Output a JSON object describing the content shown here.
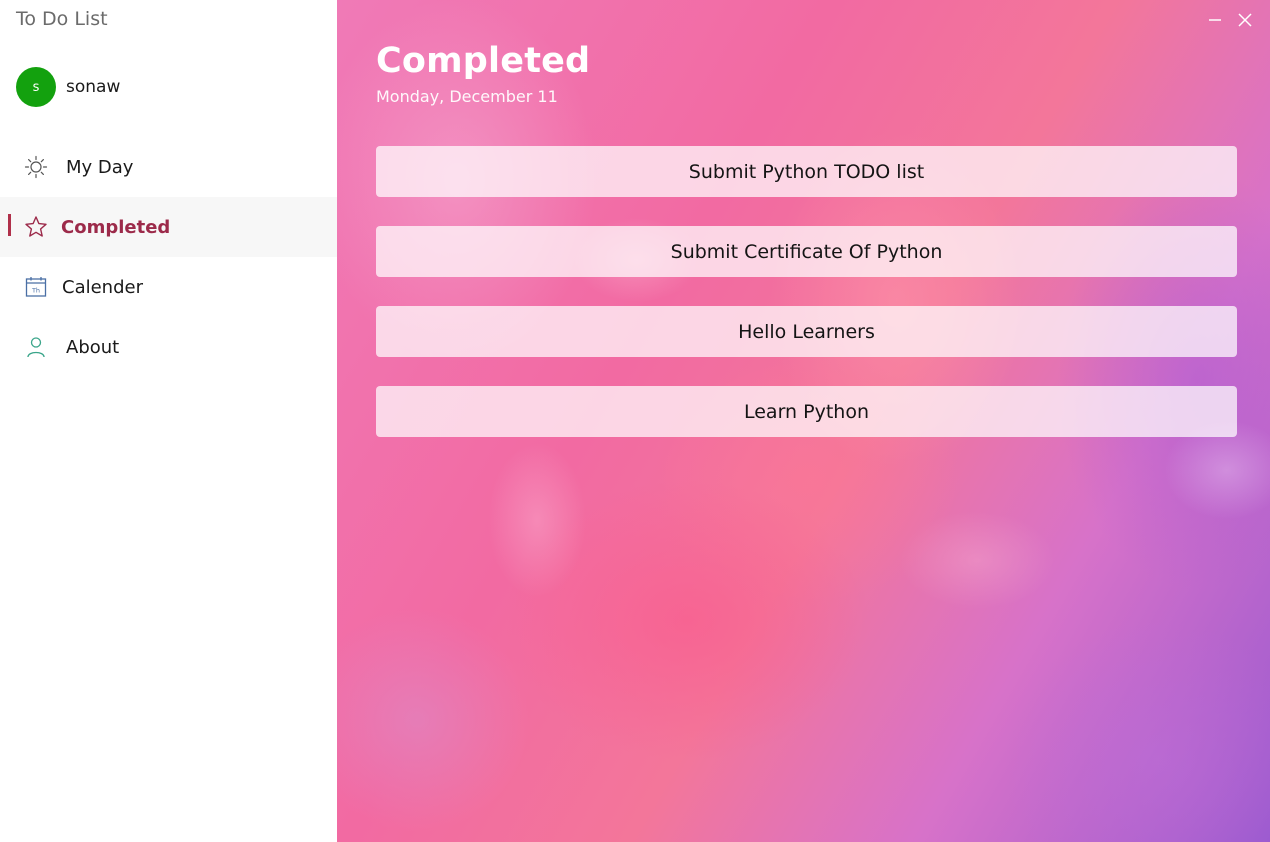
{
  "app": {
    "title": "To Do List"
  },
  "user": {
    "initial": "s",
    "name": "sonaw",
    "avatar_color": "#13a10e"
  },
  "sidebar": {
    "items": [
      {
        "label": "My Day",
        "icon": "sun-icon",
        "active": false
      },
      {
        "label": "Completed",
        "icon": "star-icon",
        "active": true
      },
      {
        "label": "Calender",
        "icon": "calendar-icon",
        "active": false
      },
      {
        "label": "About",
        "icon": "person-icon",
        "active": false
      }
    ]
  },
  "window_controls": {
    "minimize_icon": "minimize-icon",
    "close_icon": "close-icon"
  },
  "main": {
    "title": "Completed",
    "date": "Monday, December 11",
    "tasks": [
      {
        "label": "Submit Python TODO list"
      },
      {
        "label": "Submit Certificate Of Python"
      },
      {
        "label": "Hello Learners"
      },
      {
        "label": "Learn Python"
      }
    ]
  },
  "colors": {
    "accent": "#9c2a4a",
    "active_indicator": "#b0304a",
    "avatar": "#13a10e"
  }
}
